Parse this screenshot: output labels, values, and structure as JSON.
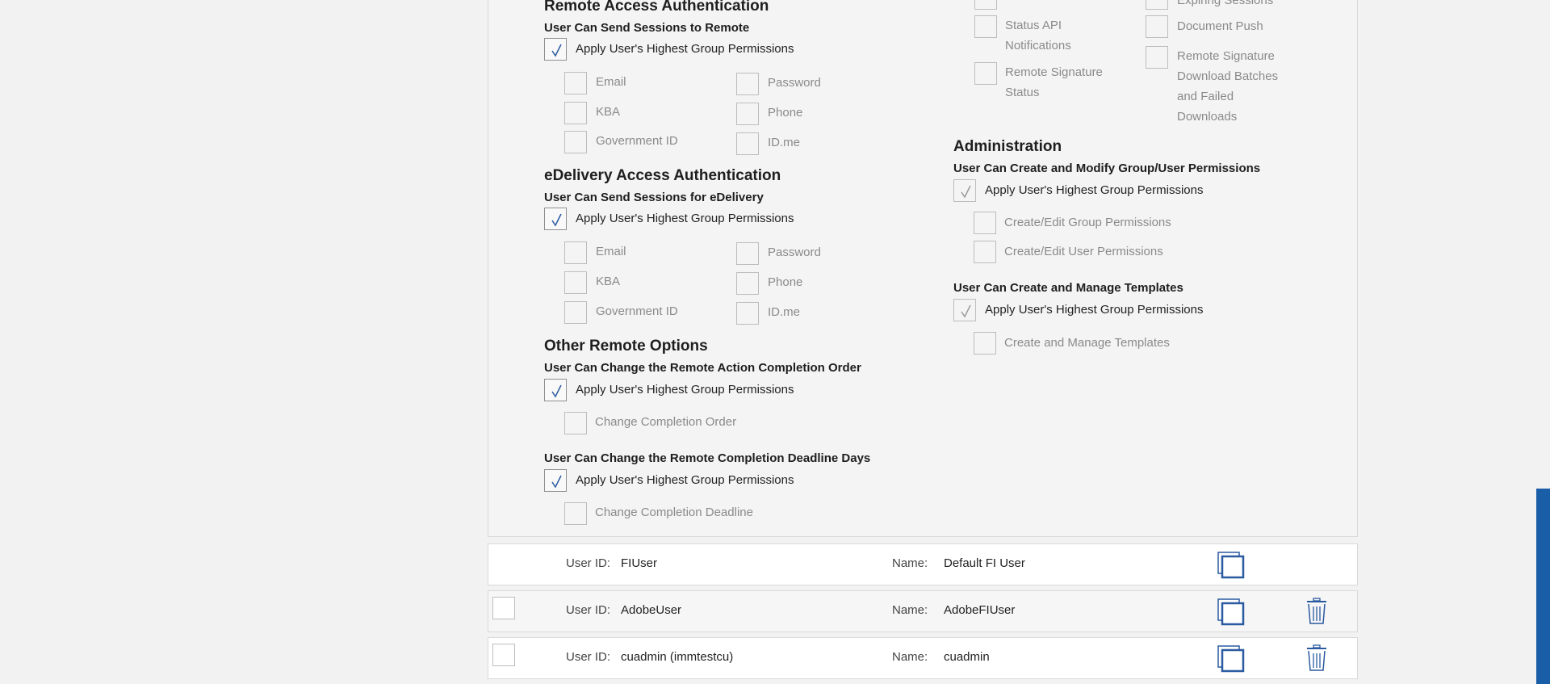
{
  "colors": {
    "accent": "#1b5ea8",
    "check": "#2a5aa0",
    "panel_bg": "#f4f4f4"
  },
  "left": {
    "remote_access": {
      "title": "Remote Access Authentication",
      "subtitle": "User Can Send Sessions to Remote",
      "apply_label": "Apply User's Highest Group Permissions",
      "apply_checked": true,
      "options": [
        "Email",
        "Password",
        "KBA",
        "Phone",
        "Government ID",
        "ID.me"
      ]
    },
    "edelivery": {
      "title": "eDelivery Access Authentication",
      "subtitle": "User Can Send Sessions for eDelivery",
      "apply_label": "Apply User's Highest Group Permissions",
      "apply_checked": true,
      "options": [
        "Email",
        "Password",
        "KBA",
        "Phone",
        "Government ID",
        "ID.me"
      ]
    },
    "other_remote": {
      "title": "Other Remote Options",
      "order_subtitle": "User Can Change the Remote Action Completion Order",
      "order_apply_label": "Apply User's Highest Group Permissions",
      "order_option": "Change Completion Order",
      "deadline_subtitle": "User Can Change the Remote Completion Deadline Days",
      "deadline_apply_label": "Apply User's Highest Group Permissions",
      "deadline_option": "Change Completion Deadline"
    }
  },
  "right": {
    "notifications": {
      "col1": [
        "Status API Notifications",
        "Remote Signature Status"
      ],
      "col2_top_partial": "Expiring Sessions",
      "col2": [
        "Document Push",
        "Remote Signature Download Batches and Failed Downloads"
      ]
    },
    "administration": {
      "title": "Administration",
      "perm_subtitle": "User Can Create and Modify Group/User Permissions",
      "perm_apply_label": "Apply User's Highest Group Permissions",
      "perm_options": [
        "Create/Edit Group Permissions",
        "Create/Edit User Permissions"
      ],
      "templates_subtitle": "User Can Create and Manage Templates",
      "templates_apply_label": "Apply User's Highest Group Permissions",
      "templates_option": "Create and Manage Templates"
    }
  },
  "users": {
    "user_id_label": "User ID:",
    "name_label": "Name:",
    "rows": [
      {
        "user_id": "FIUser",
        "name": "Default FI User",
        "has_checkbox": false,
        "has_delete": false
      },
      {
        "user_id": "AdobeUser",
        "name": "AdobeFIUser",
        "has_checkbox": true,
        "has_delete": true
      },
      {
        "user_id": "cuadmin (immtestcu)",
        "name": "cuadmin",
        "has_checkbox": true,
        "has_delete": true
      }
    ]
  }
}
